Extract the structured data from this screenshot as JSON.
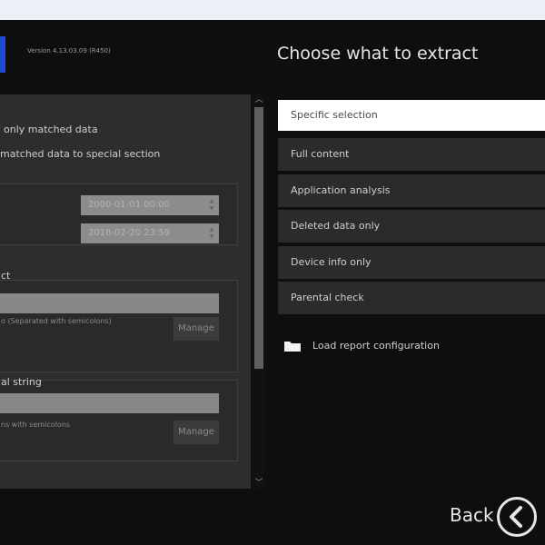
{
  "header": {
    "version_text": "Version 4.13.03.09 (R450)",
    "right_title": "Choose what to extract"
  },
  "left": {
    "option1": "only matched data",
    "option2": "matched data to special section",
    "date_from": "2000-01-01 00:00",
    "date_to": "2018-02-20 23:59",
    "group1_label": "ct",
    "group1_hint": "o (Separated with semicolons)",
    "group1_manage": "Manage",
    "group2_label": "al string",
    "group2_hint": "ns with semicolons",
    "group2_manage": "Manage"
  },
  "modes": [
    {
      "label": "Specific selection"
    },
    {
      "label": "Full content"
    },
    {
      "label": "Application analysis"
    },
    {
      "label": "Deleted data only"
    },
    {
      "label": "Device info only"
    },
    {
      "label": "Parental check"
    }
  ],
  "load_report": "Load report configuration",
  "footer": {
    "back_label": "Back"
  },
  "colors": {
    "background": "#0e0e0e",
    "panel": "#2d2d2d",
    "selected": "#ffffff",
    "accent_logo": "#1e4bd6"
  },
  "icons": {
    "folder": "folder-icon",
    "back": "chevron-left-icon",
    "scroll_up": "chevron-up-icon",
    "scroll_down": "chevron-down-icon"
  }
}
